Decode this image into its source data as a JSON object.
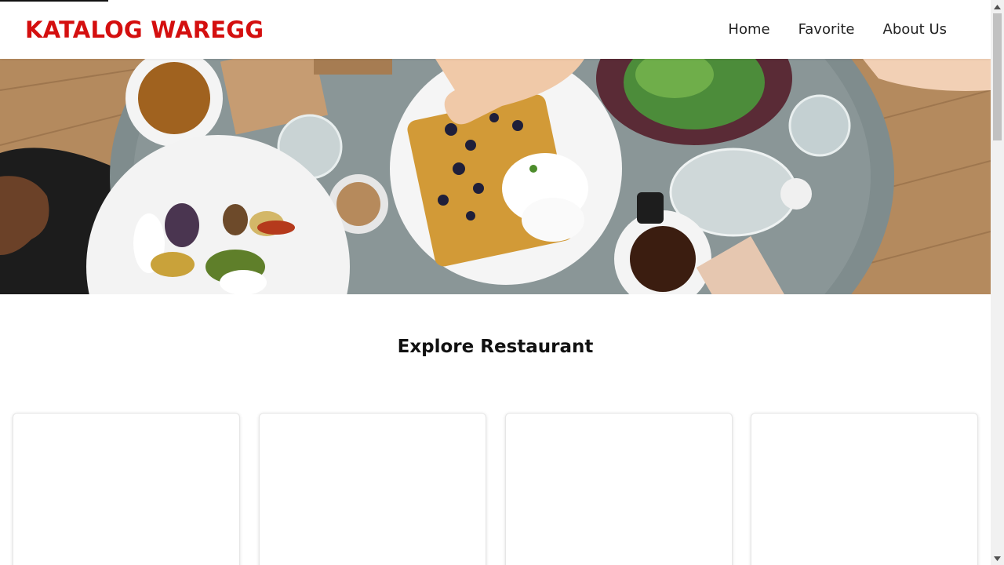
{
  "header": {
    "brand": "KATALOG WAREGG",
    "nav": [
      {
        "label": "Home"
      },
      {
        "label": "Favorite"
      },
      {
        "label": "About Us"
      }
    ]
  },
  "hero": {
    "image": "breakfast-table-photo"
  },
  "main": {
    "title": "Explore Restaurant",
    "cards": [
      {},
      {},
      {},
      {}
    ]
  },
  "colors": {
    "brand": "#d40f0f",
    "background": "#ffffff",
    "text": "#222222"
  }
}
